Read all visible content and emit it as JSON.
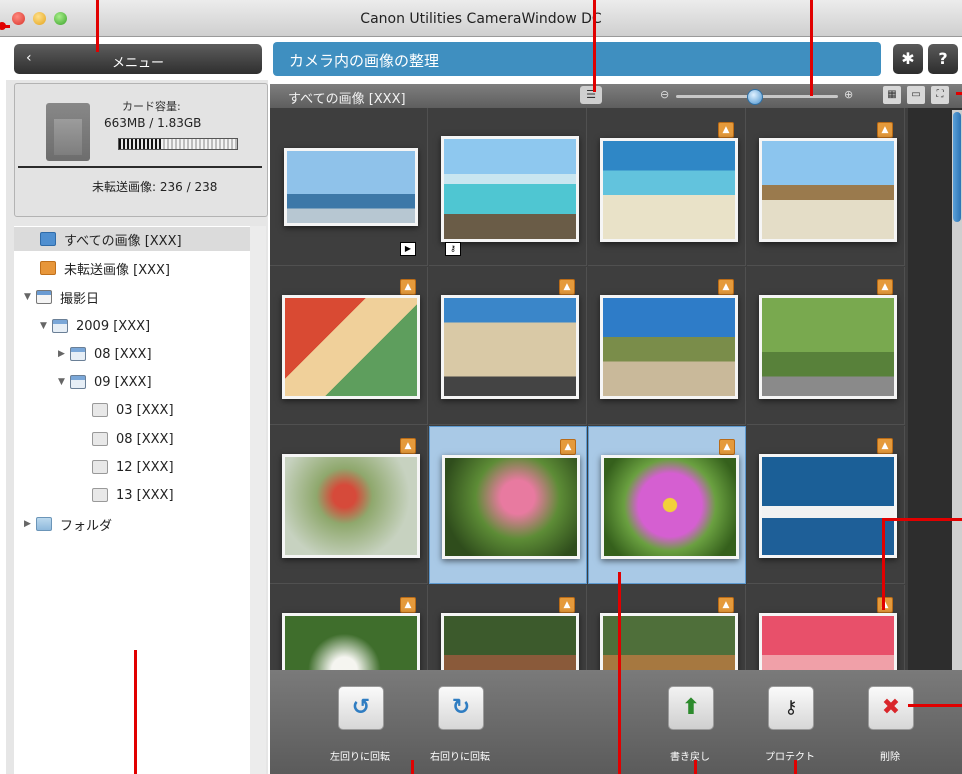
{
  "window": {
    "title": "Canon Utilities CameraWindow DC"
  },
  "nav": {
    "menu_label": "メニュー",
    "section_title": "カメラ内の画像の整理",
    "settings_icon": "gear-icon",
    "help_label": "?"
  },
  "card": {
    "capacity_label": "カード容量:",
    "capacity_value": "663MB / 1.83GB",
    "capacity_used_fraction": 0.36,
    "untransferred_label": "未転送画像:",
    "untransferred_value": "236 / 238"
  },
  "tree": {
    "items": [
      {
        "label": "すべての画像 [XXX]",
        "icon": "all-images-icon"
      },
      {
        "label": "未転送画像 [XXX]",
        "icon": "untransferred-icon"
      },
      {
        "label": "撮影日",
        "icon": "calendar-icon"
      },
      {
        "label": "2009 [XXX]",
        "icon": "calendar-icon"
      },
      {
        "label": "08 [XXX]",
        "icon": "calendar-icon"
      },
      {
        "label": "09 [XXX]",
        "icon": "calendar-icon"
      },
      {
        "label": "03 [XXX]",
        "icon": "day-icon"
      },
      {
        "label": "08 [XXX]",
        "icon": "day-icon"
      },
      {
        "label": "12 [XXX]",
        "icon": "day-icon"
      },
      {
        "label": "13 [XXX]",
        "icon": "day-icon"
      },
      {
        "label": "フォルダ",
        "icon": "folder-icon"
      }
    ]
  },
  "grid": {
    "filter_label": "すべての画像 [XXX]",
    "zoom_level": 0.48
  },
  "actions": {
    "rotate_left": "左回りに回転",
    "rotate_right": "右回りに回転",
    "write_back": "書き戻し",
    "protect": "プロテクト",
    "delete": "削除"
  },
  "colors": {
    "accent": "#3f8fc0",
    "badge": "#e59a3b",
    "selection": "#a9c9e6",
    "annotation": "#e10000"
  }
}
